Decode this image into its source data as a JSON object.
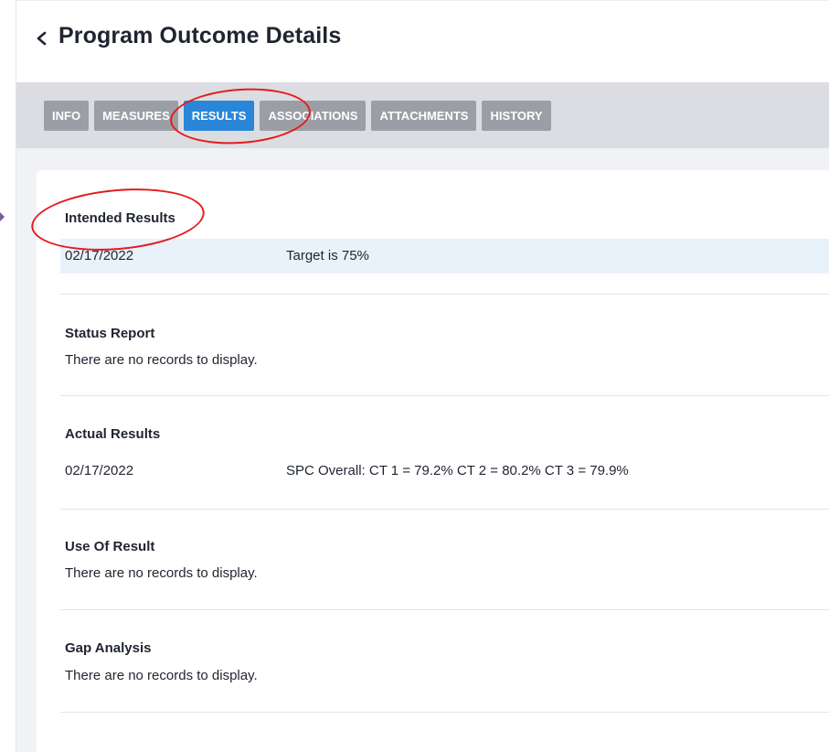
{
  "header": {
    "title": "Program Outcome Details"
  },
  "tabs": [
    {
      "label": "INFO",
      "active": false
    },
    {
      "label": "MEASURES",
      "active": false
    },
    {
      "label": "RESULTS",
      "active": true
    },
    {
      "label": "ASSOCIATIONS",
      "active": false
    },
    {
      "label": "ATTACHMENTS",
      "active": false
    },
    {
      "label": "HISTORY",
      "active": false
    }
  ],
  "sections": {
    "intended": {
      "title": "Intended Results",
      "rows": [
        {
          "date": "02/17/2022",
          "text": "Target is 75%"
        }
      ]
    },
    "status": {
      "title": "Status Report",
      "empty": "There are no records to display."
    },
    "actual": {
      "title": "Actual Results",
      "rows": [
        {
          "date": "02/17/2022",
          "text": "SPC Overall: CT 1 = 79.2% CT 2 = 80.2% CT 3 = 79.9%"
        }
      ]
    },
    "use": {
      "title": "Use Of Result",
      "empty": "There are no records to display."
    },
    "gap": {
      "title": "Gap Analysis",
      "empty": "There are no records to display."
    }
  },
  "colors": {
    "active_tab": "#2a86d8",
    "inactive_tab": "#9c9ea5",
    "annotation": "#e41b1b",
    "row_highlight": "#e9f1fb"
  },
  "icons": {
    "back": "chevron-left-icon",
    "rail_marker": "triangle-right-icon"
  }
}
